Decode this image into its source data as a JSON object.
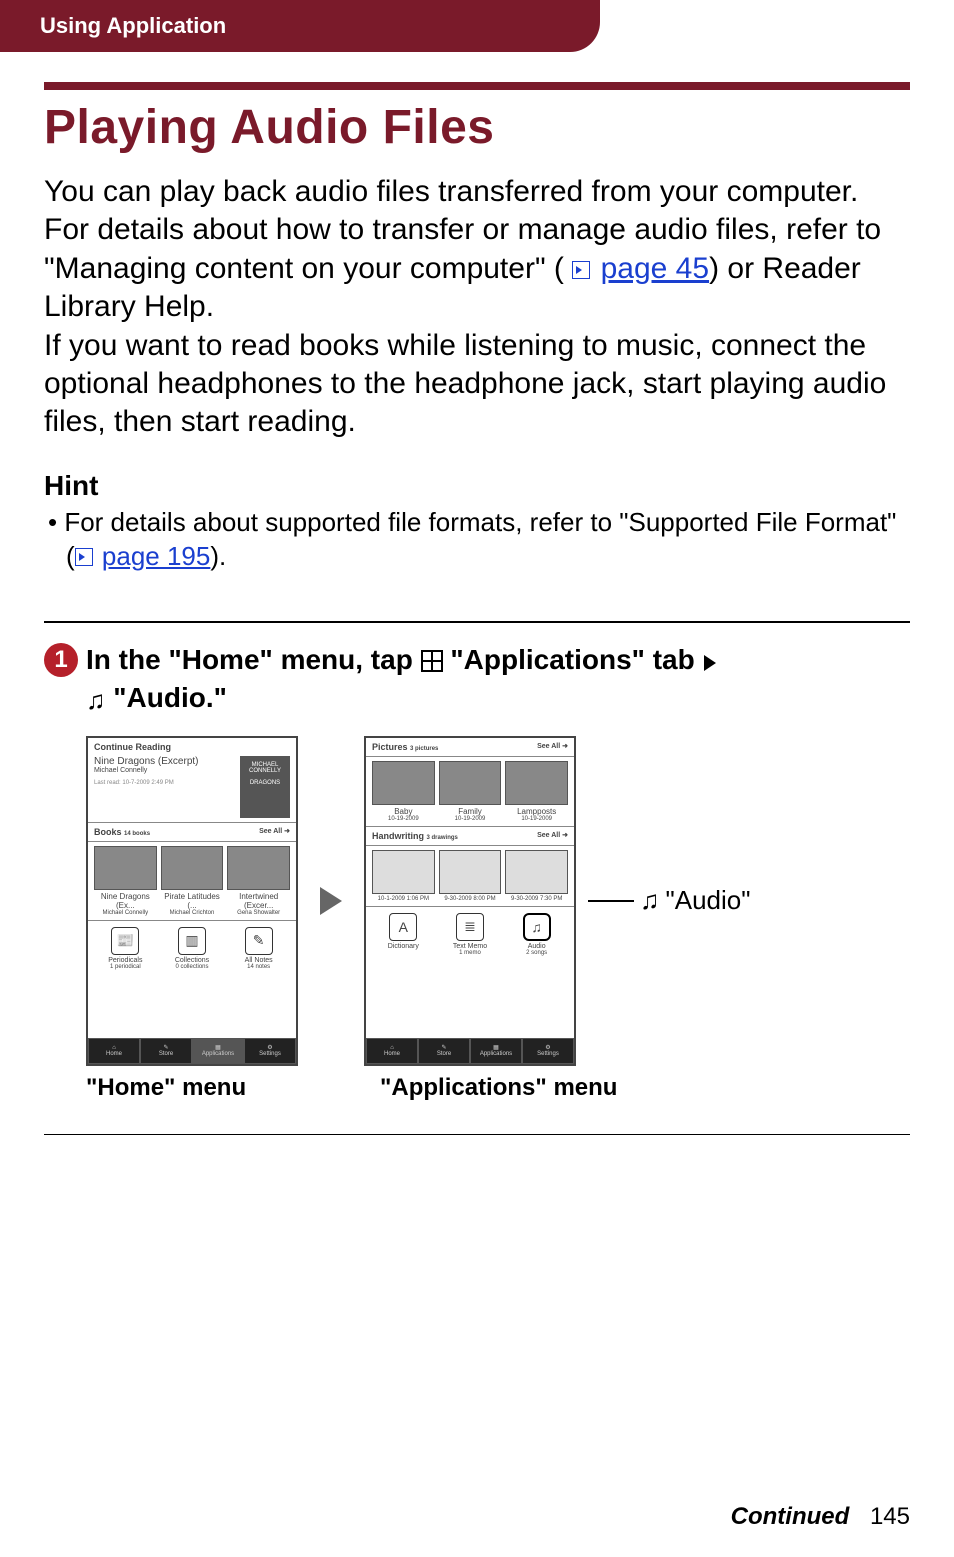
{
  "header": {
    "section": "Using Application"
  },
  "title": "Playing Audio Files",
  "intro": {
    "p1a": "You can play back audio files transferred from your computer. For details about how to transfer or manage audio files, refer to \"Managing content on your computer\" (",
    "link1": "page 45",
    "p1b": ") or Reader Library Help.",
    "p2": "If you want to read books while listening to music, connect the optional headphones to the headphone jack, start playing audio files, then start reading."
  },
  "hint": {
    "title": "Hint",
    "bullet_a": "For details about supported file formats, refer to \"Supported File Format\" (",
    "bullet_link": "page 195",
    "bullet_b": ")."
  },
  "step": {
    "num": "1",
    "t1": "In the \"Home\" menu, tap ",
    "t2": " \"Applications\" tab ",
    "t3": " \"Audio.\""
  },
  "screens": {
    "home": {
      "continue": "Continue Reading",
      "book_title": "Nine Dragons (Excerpt)",
      "book_author": "Michael Connelly",
      "last_read": "Last read: 10-7-2009 2:49 PM",
      "books": "Books",
      "books_count": "14 books",
      "see_all": "See All",
      "b1": "Nine Dragons (Ex...",
      "b1a": "Michael Connelly",
      "b2": "Pirate Latitudes (...",
      "b2a": "Michael Crichton",
      "b3": "Intertwined (Excer...",
      "b3a": "Gena Showalter",
      "i1": "Periodicals",
      "i1s": "1 periodical",
      "i2": "Collections",
      "i2s": "0 collections",
      "i3": "All Notes",
      "i3s": "14 notes",
      "nav": {
        "home": "Home",
        "store": "Store",
        "apps": "Applications",
        "settings": "Settings"
      }
    },
    "apps": {
      "pictures": "Pictures",
      "pictures_count": "3 pictures",
      "see_all": "See All",
      "p1": "Baby",
      "p1d": "10-19-2009",
      "p2": "Family",
      "p2d": "10-19-2009",
      "p3": "Lampposts",
      "p3d": "10-19-2009",
      "hand": "Handwriting",
      "hand_count": "3 drawings",
      "h1": "10-1-2009 1:06 PM",
      "h2": "9-30-2009 8:00 PM",
      "h3": "9-30-2009 7:30 PM",
      "dict": "Dictionary",
      "memo": "Text Memo",
      "memo_s": "1 memo",
      "audio": "Audio",
      "audio_s": "2 songs",
      "nav": {
        "home": "Home",
        "store": "Store",
        "apps": "Applications",
        "settings": "Settings"
      }
    },
    "callout": "\"Audio\"",
    "caption1": "\"Home\" menu",
    "caption2": "\"Applications\" menu"
  },
  "footer": {
    "continued": "Continued",
    "page": "145"
  }
}
